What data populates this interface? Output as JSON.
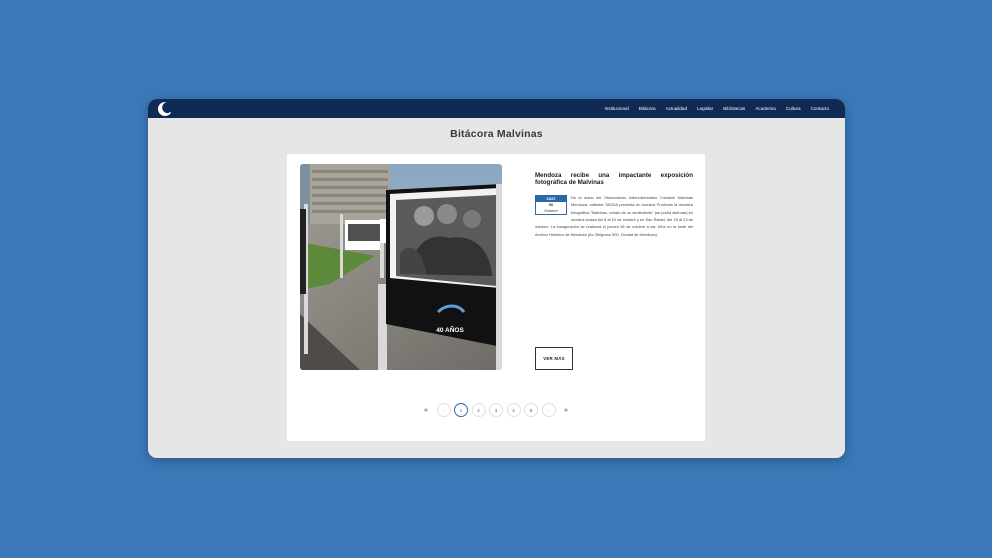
{
  "header": {
    "logo_icon": "crescent-moon-logo",
    "nav_items": [
      "Institucional",
      "Bitácora",
      "Actualidad",
      "Legislar",
      "Bibliotecas",
      "Academia",
      "Cultura",
      "Contacto"
    ]
  },
  "page": {
    "title": "Bitácora Malvinas"
  },
  "article": {
    "title": "Mendoza recibe una impactante exposición fotográfica de Malvinas",
    "date": {
      "year": "2022",
      "day": "06",
      "month": "Octubre"
    },
    "body": "De la mano del Observatorio Interuniversitario Cuestión Malvinas Mendoza, editorial TAGDA presenta en nuestra Provincia la muestra fotográfica \"Malvinas, retrato de un sentimiento\" (se podrá disfrutar) en nuestra ciudad del 6 al 10 de octubre y en San Rafael, del 18 al 23 de octubre. La inauguración se realizará el jueves 06 de octubre a las 19hs en la sede del Archivo Histórico de Mendoza (Av. Belgrano 500, Ciudad de Mendoza).",
    "button_label": "VER MÁS",
    "photo_caption": "40 AÑOS",
    "photo_icon": "exhibition-photo"
  },
  "pagination": {
    "first": "«",
    "prev": "‹",
    "pages": [
      "1",
      "2",
      "3",
      "4",
      "5"
    ],
    "active_page": "1",
    "next": "›",
    "last": "»"
  },
  "colors": {
    "background": "#3a78b7",
    "navbar": "#0f2a55",
    "accent": "#2c6aa6",
    "content_bg": "#e6e6e6"
  }
}
